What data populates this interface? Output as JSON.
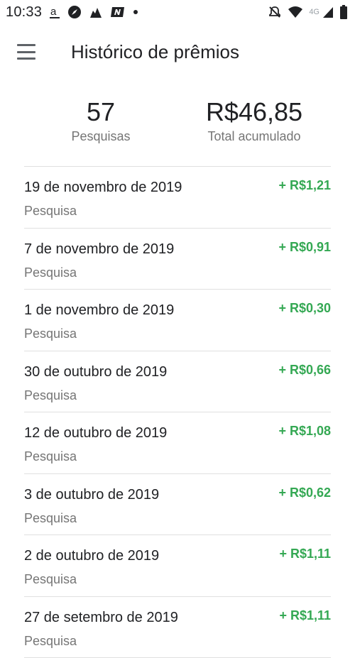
{
  "status_bar": {
    "time": "10:33",
    "network": "4G",
    "icons_left": [
      "amazon-icon",
      "compass-icon",
      "app-icon",
      "nubank-icon",
      "dot-icon"
    ],
    "icons_right": [
      "mute-icon",
      "wifi-icon",
      "signal-icon",
      "battery-icon"
    ]
  },
  "app_bar": {
    "title": "Histórico de prêmios"
  },
  "summary": {
    "count_value": "57",
    "count_label": "Pesquisas",
    "total_value": "R$46,85",
    "total_label": "Total acumulado"
  },
  "rewards": [
    {
      "date": "19 de novembro de 2019",
      "type": "Pesquisa",
      "amount": "+ R$1,21"
    },
    {
      "date": "7 de novembro de 2019",
      "type": "Pesquisa",
      "amount": "+ R$0,91"
    },
    {
      "date": "1 de novembro de 2019",
      "type": "Pesquisa",
      "amount": "+ R$0,30"
    },
    {
      "date": "30 de outubro de 2019",
      "type": "Pesquisa",
      "amount": "+ R$0,66"
    },
    {
      "date": "12 de outubro de 2019",
      "type": "Pesquisa",
      "amount": "+ R$1,08"
    },
    {
      "date": "3 de outubro de 2019",
      "type": "Pesquisa",
      "amount": "+ R$0,62"
    },
    {
      "date": "2 de outubro de 2019",
      "type": "Pesquisa",
      "amount": "+ R$1,11"
    },
    {
      "date": "27 de setembro de 2019",
      "type": "Pesquisa",
      "amount": "+ R$1,11"
    }
  ],
  "colors": {
    "accent_green": "#34a853",
    "secondary_text": "#757575"
  }
}
